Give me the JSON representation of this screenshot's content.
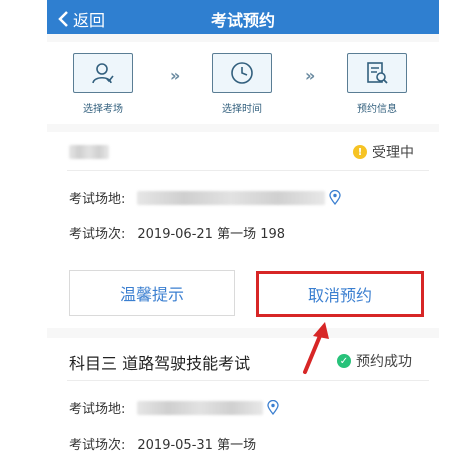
{
  "nav": {
    "back_label": "返回",
    "title": "考试预约"
  },
  "steps": [
    {
      "label": "选择考场"
    },
    {
      "label": "选择时间"
    },
    {
      "label": "预约信息"
    }
  ],
  "card1": {
    "status": "受理中",
    "location_label": "考试场地:",
    "session_label": "考试场次:",
    "session_value": "2019-06-21 第一场 198"
  },
  "buttons": {
    "tips": "温馨提示",
    "cancel": "取消预约"
  },
  "card2": {
    "subject": "科目三 道路驾驶技能考试",
    "status": "预约成功",
    "location_label": "考试场地:",
    "session_label": "考试场次:",
    "session_value": "2019-05-31 第一场"
  },
  "colors": {
    "nav": "#2f7fd0",
    "highlight": "#d72626",
    "success": "#27c27a",
    "pending": "#f6c324",
    "link": "#3b7fd0"
  }
}
